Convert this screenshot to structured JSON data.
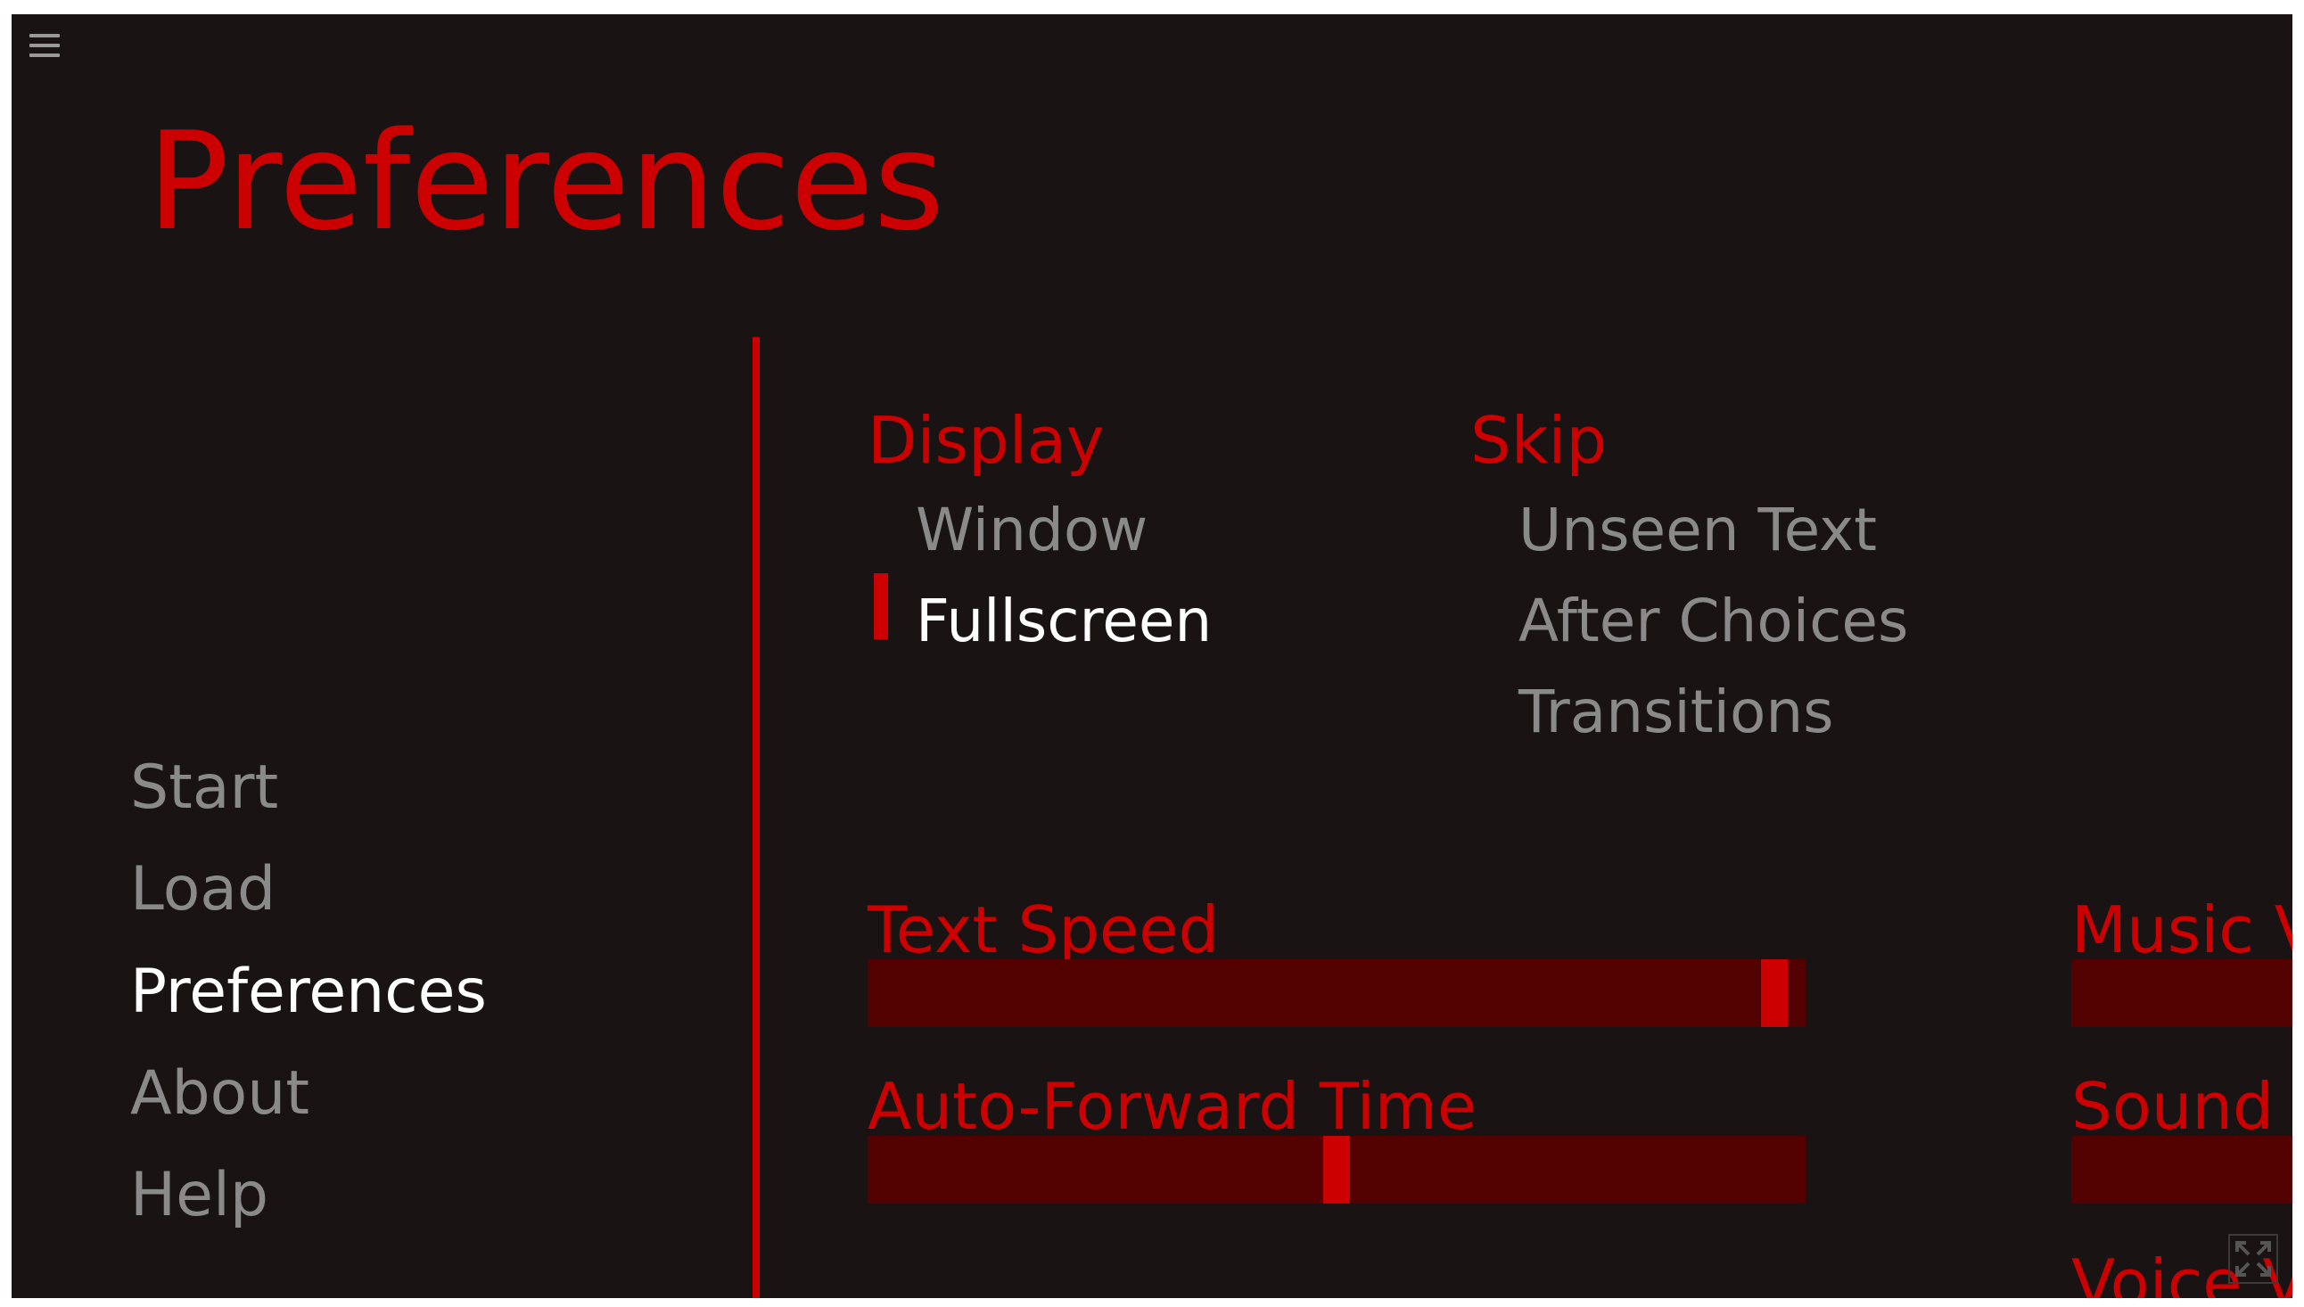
{
  "screen": {
    "title": "Preferences"
  },
  "nav": {
    "items": [
      {
        "label": "Start"
      },
      {
        "label": "Load"
      },
      {
        "label": "Preferences"
      },
      {
        "label": "About"
      },
      {
        "label": "Help"
      }
    ],
    "active": "Preferences"
  },
  "display": {
    "heading": "Display",
    "options": [
      {
        "label": "Window",
        "selected": false
      },
      {
        "label": "Fullscreen",
        "selected": true
      }
    ]
  },
  "skip": {
    "heading": "Skip",
    "options": [
      {
        "label": "Unseen Text"
      },
      {
        "label": "After Choices"
      },
      {
        "label": "Transitions"
      }
    ]
  },
  "sliders": {
    "text_speed": {
      "label": "Text Speed",
      "value": 0.98
    },
    "auto_forward": {
      "label": "Auto-Forward Time",
      "value": 0.5
    },
    "music_volume": {
      "label": "Music V"
    },
    "sound_volume": {
      "label": "Sound "
    },
    "voice_volume": {
      "label": "Voice V"
    }
  },
  "icons": {
    "menu": "hamburger-menu-icon",
    "fullscreen": "fullscreen-icon"
  },
  "colors": {
    "background": "#191314",
    "accent": "#cc0000",
    "bar_track": "#520000",
    "idle_text": "#8a8a8a",
    "active_text": "#ffffff"
  }
}
